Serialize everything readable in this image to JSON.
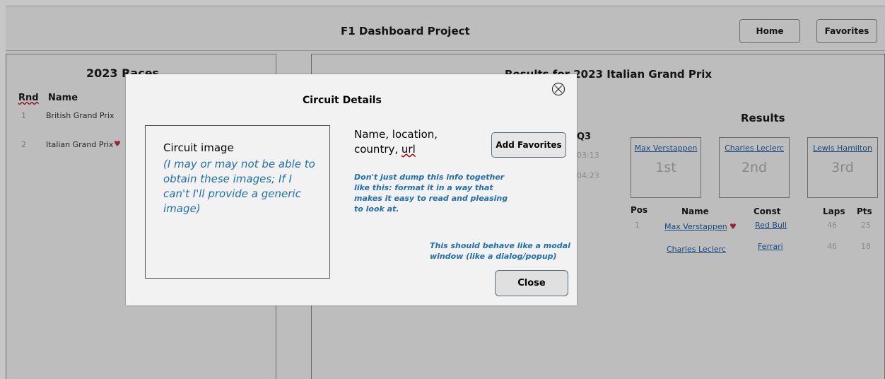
{
  "header": {
    "title": "F1 Dashboard Project",
    "home_label": "Home",
    "favorites_label": "Favorites"
  },
  "races": {
    "title": "2023 Races",
    "col_rnd": "Rnd",
    "col_name": "Name",
    "rows": [
      {
        "rnd": "1",
        "name": "British Grand Prix"
      },
      {
        "rnd": "2",
        "name": "Italian Grand Prix",
        "favorite_icon": "heart-icon"
      }
    ]
  },
  "results": {
    "title": "Results for 2023 Italian Grand Prix",
    "subtitle": "Results",
    "qualifying_header": "Q3",
    "qualifying_times": [
      "03:13",
      "04:23"
    ],
    "podium": [
      {
        "name": "Max Verstappen",
        "place": "1st"
      },
      {
        "name": "Charles Leclerc",
        "place": "2nd"
      },
      {
        "name": "Lewis Hamilton",
        "place": "3rd"
      }
    ],
    "columns": {
      "pos": "Pos",
      "name": "Name",
      "const": "Const",
      "laps": "Laps",
      "pts": "Pts"
    },
    "rows": [
      {
        "pos": "1",
        "name": "Max Verstappen",
        "const": "Red Bull",
        "laps": "46",
        "pts": "25",
        "favorite_icon": "heart-icon"
      },
      {
        "pos": "",
        "name": "Charles Leclerc",
        "const": "Ferrari",
        "laps": "46",
        "pts": "18"
      }
    ]
  },
  "modal": {
    "title": "Circuit Details",
    "close_icon": "close-circle-icon",
    "image_label": "Circuit image",
    "image_note": "(I may or may not be able to obtain these images; If I can't I'll provide a generic image)",
    "details_line1": "Name, location,",
    "details_line2a": "country, ",
    "details_line2b": "url",
    "add_favorites_label": "Add Favorites",
    "note_format": "Don't just dump this info together like this: format it in a way that makes it easy to read and pleasing to look at.",
    "note_modal": "This should behave like a modal window (like a dialog/popup)",
    "close_label": "Close"
  },
  "colors": {
    "link": "#1f5fa0",
    "annotation": "#1f6fb2",
    "heart": "#c0304a",
    "overlay": "rgba(0,0,0,0.22)"
  }
}
